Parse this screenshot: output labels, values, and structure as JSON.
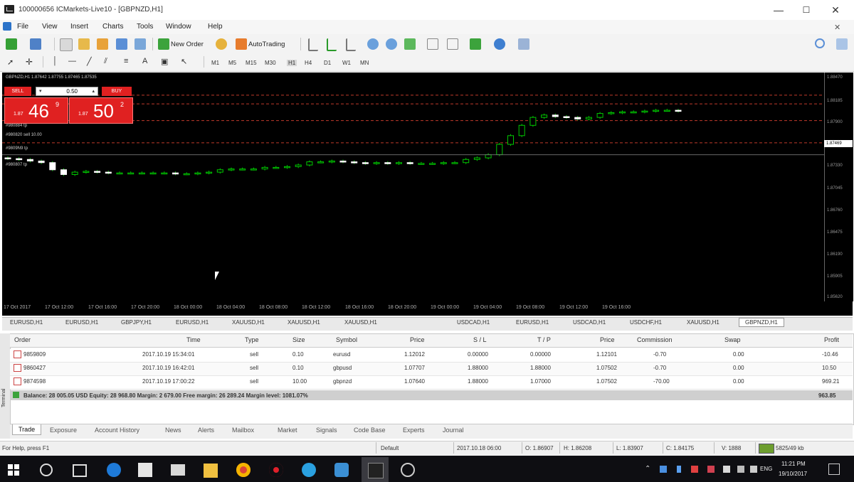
{
  "window": {
    "title": "100000656 ICMarkets-Live10 - [GBPNZD,H1]",
    "minimize_glyph": "—",
    "maximize_glyph": "☐",
    "close_glyph": "✕"
  },
  "menu": [
    "File",
    "View",
    "Insert",
    "Charts",
    "Tools",
    "Window",
    "Help"
  ],
  "toolbar": {
    "new_order_label": "New Order",
    "autotrading_label": "AutoTrading"
  },
  "timeframes": [
    "M1",
    "M5",
    "M15",
    "M30",
    "H1",
    "H4",
    "D1",
    "W1",
    "MN"
  ],
  "chart": {
    "info": "GBPNZD,H1  1.87642 1.87755 1.87465 1.87535",
    "one_click": {
      "sell_label": "SELL",
      "buy_label": "BUY",
      "lot": "0.50",
      "sell_prefix": "1.87",
      "sell_big": "46",
      "sell_sup": "9",
      "buy_prefix": "1.87",
      "buy_big": "50",
      "buy_sup": "2"
    },
    "order_lines": [
      {
        "label": "#980884 tp",
        "y_price": 1.8822
      },
      {
        "label": "#980820 sell 10.00",
        "y_price": 1.8811
      },
      {
        "label": "#9809N9 tp",
        "y_price": 1.879
      },
      {
        "label": "#980807 tp",
        "y_price": 1.8762
      }
    ],
    "price_ticks": [
      "1.88470",
      "1.88185",
      "1.87900",
      "1.87615",
      "1.87330",
      "1.87045",
      "1.86760",
      "1.86475",
      "1.86190",
      "1.85905",
      "1.85620"
    ],
    "current_price": "1.87469",
    "time_ticks": [
      "17 Oct 2017",
      "17 Oct 12:00",
      "17 Oct 16:00",
      "17 Oct 20:00",
      "18 Oct 00:00",
      "18 Oct 04:00",
      "18 Oct 08:00",
      "18 Oct 12:00",
      "18 Oct 16:00",
      "18 Oct 20:00",
      "19 Oct 00:00",
      "19 Oct 04:00",
      "19 Oct 08:00",
      "19 Oct 12:00",
      "19 Oct 16:00"
    ]
  },
  "chart_tabs": [
    "EURUSD,H1",
    "EURUSD,H1",
    "GBPJPY,H1",
    "EURUSD,H1",
    "XAUUSD,H1",
    "XAUUSD,H1",
    "XAUUSD,H1",
    "USDCAD,H1",
    "EURUSD,H1",
    "USDCAD,H1",
    "USDCHF,H1",
    "XAUUSD,H1",
    "GBPNZD,H1"
  ],
  "terminal": {
    "columns": [
      "Order",
      "Time",
      "Type",
      "Size",
      "Symbol",
      "Price",
      "S / L",
      "T / P",
      "Price",
      "Commission",
      "Swap",
      "Profit"
    ],
    "rows": [
      [
        "9859809",
        "2017.10.19 15:34:01",
        "sell",
        "0.10",
        "eurusd",
        "1.12012",
        "0.00000",
        "0.00000",
        "1.12101",
        "-0.70",
        "0.00",
        "-10.46"
      ],
      [
        "9860427",
        "2017.10.19 16:42:01",
        "sell",
        "0.10",
        "gbpusd",
        "1.07707",
        "1.88000",
        "1.88000",
        "1.07502",
        "-0.70",
        "0.00",
        "10.50"
      ],
      [
        "9874598",
        "2017.10.19 17:00:22",
        "sell",
        "10.00",
        "gbpnzd",
        "1.07640",
        "1.88000",
        "1.07000",
        "1.07502",
        "-70.00",
        "0.00",
        "969.21"
      ]
    ],
    "balance_text": "Balance: 28 005.05 USD  Equity: 28 968.80  Margin: 2 679.00  Free margin: 26 289.24  Margin level: 1081.07%",
    "total_profit": "963.85",
    "tabs": [
      "Trade",
      "Exposure",
      "Account History",
      "News",
      "Alerts",
      "Mailbox",
      "Market",
      "Signals",
      "Code Base",
      "Experts",
      "Journal"
    ],
    "side_label": "Terminal"
  },
  "status": {
    "help": "For Help, press F1",
    "profile": "Default",
    "datetime": "2017.10.18 06:00",
    "open": "O: 1.86907",
    "high": "H: 1.86208",
    "low": "L: 1.83907",
    "close": "C: 1.84175",
    "volume": "V: 1888",
    "traffic": "5825/49 kb"
  },
  "taskbar": {
    "time": "11:21 PM",
    "date": "19/10/2017",
    "lang": "ENG"
  },
  "colors": {
    "chart_bg": "#000000",
    "candle": "#00c800",
    "sell_red": "#e02121",
    "order_line": "#c0392b"
  }
}
